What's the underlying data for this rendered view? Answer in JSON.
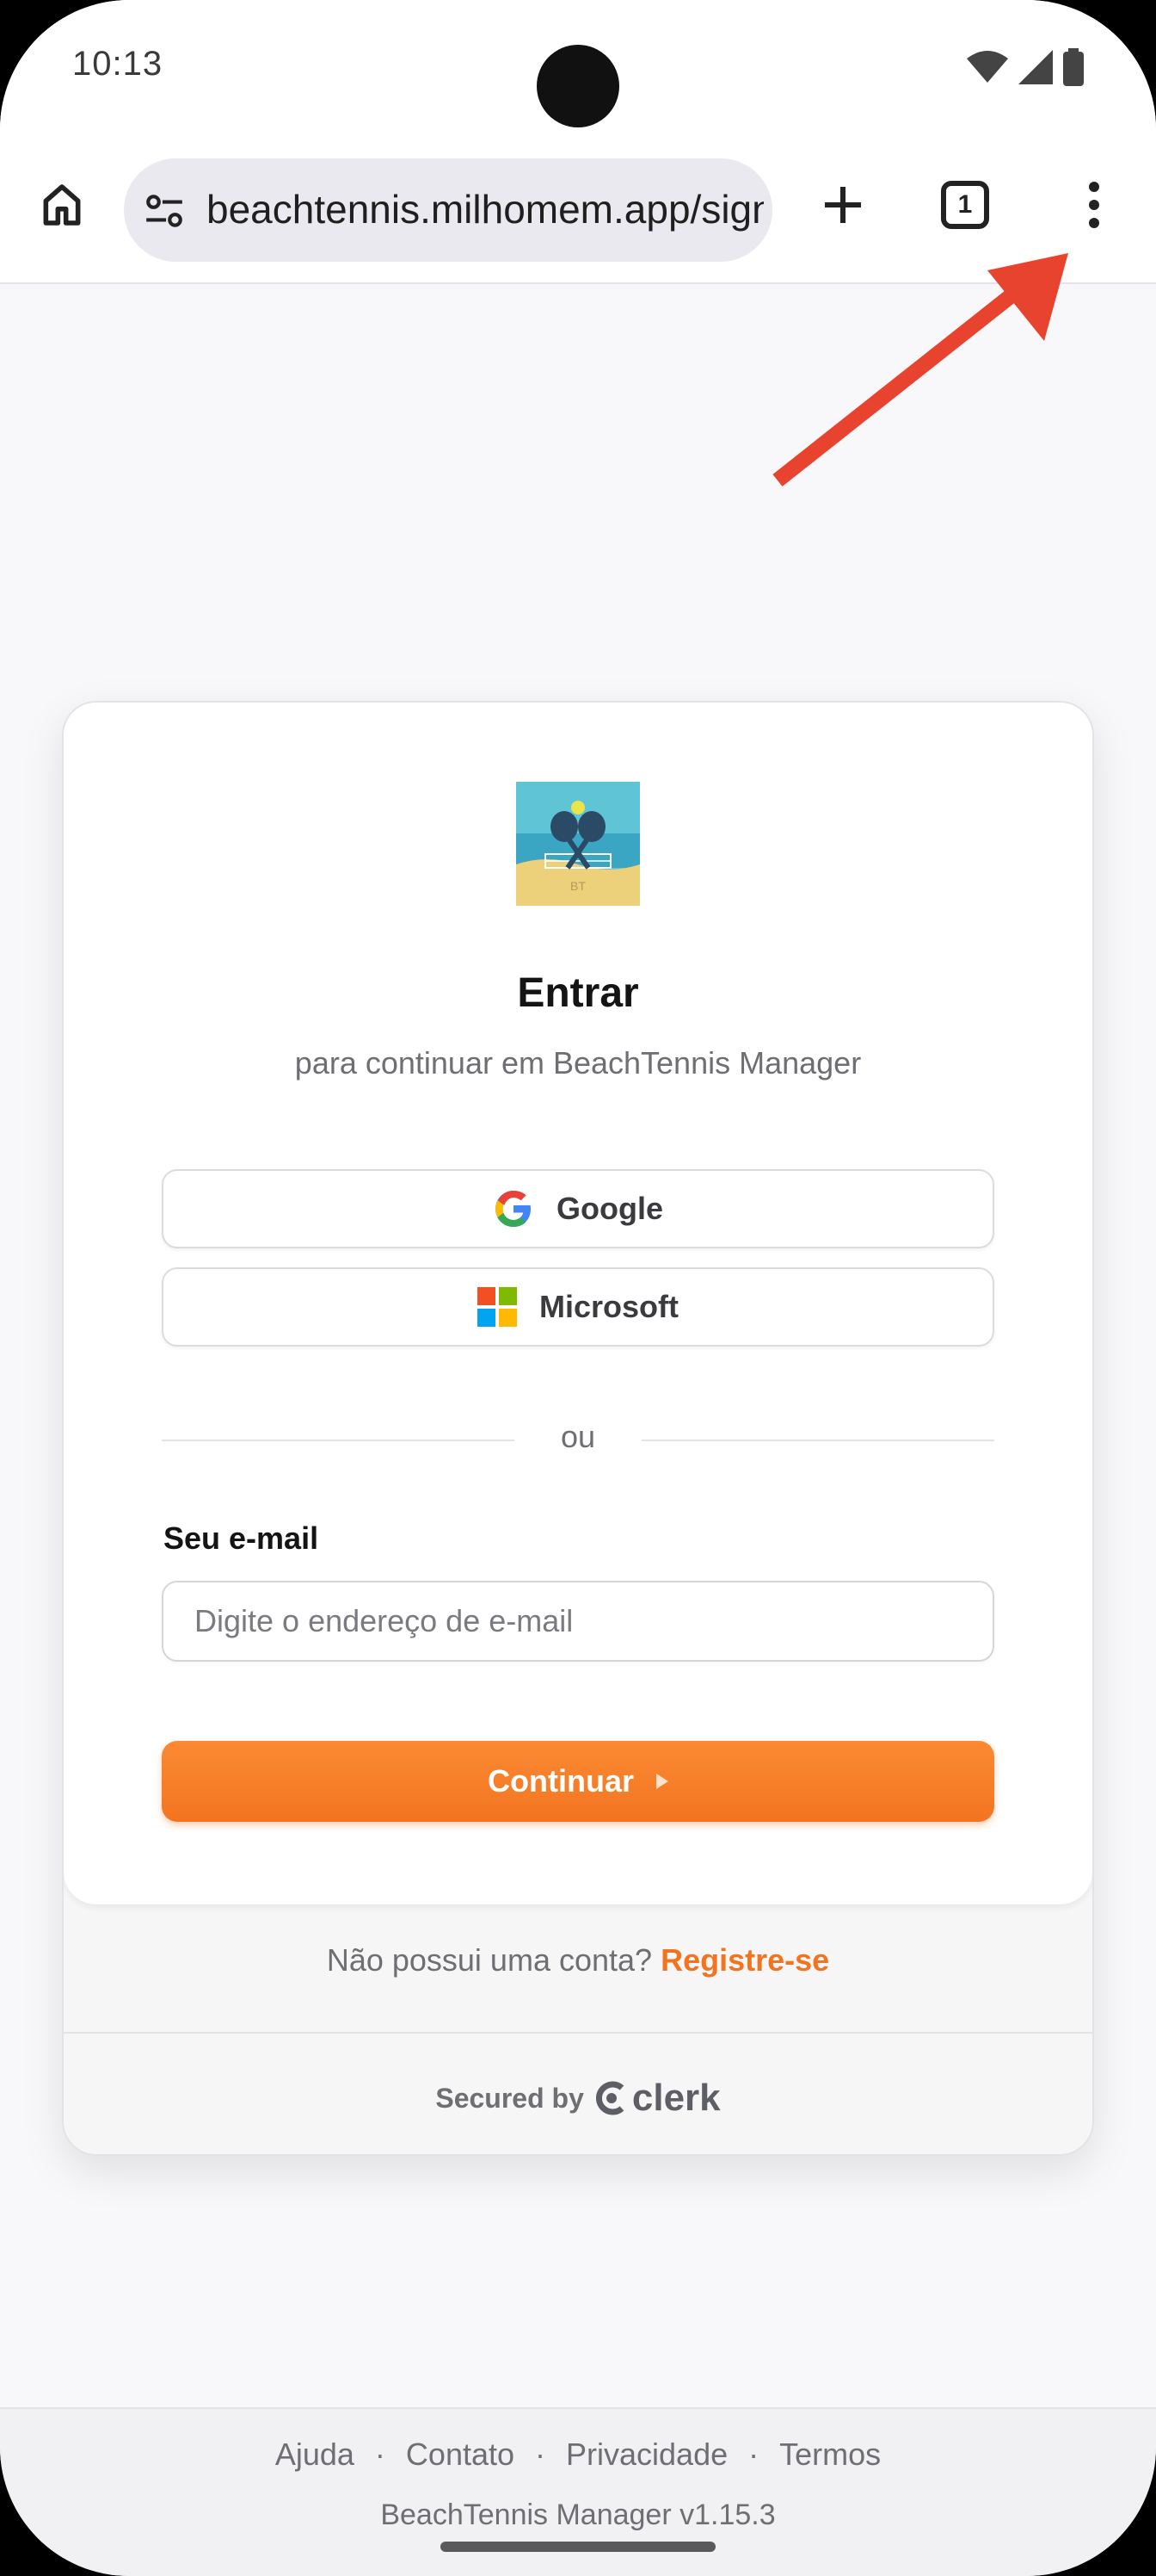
{
  "status_bar": {
    "time": "10:13"
  },
  "browser": {
    "url": "beachtennis.milhomem.app/sign-in",
    "tab_count": "1"
  },
  "signin": {
    "logo_text": "BT",
    "title": "Entrar",
    "subtitle": "para continuar em BeachTennis Manager",
    "google_label": "Google",
    "microsoft_label": "Microsoft",
    "divider": "ou",
    "email_label": "Seu e-mail",
    "email_placeholder": "Digite o endereço de e-mail",
    "email_value": "",
    "continue_label": "Continuar",
    "signup_prompt": "Não possui uma conta?",
    "signup_link": "Registre-se",
    "secured_by": "Secured by",
    "clerk": "clerk"
  },
  "footer": {
    "links": [
      "Ajuda",
      "Contato",
      "Privacidade",
      "Termos"
    ],
    "version": "BeachTennis Manager v1.15.3"
  },
  "colors": {
    "accent": "#f37420",
    "annotation_arrow": "#e8432e"
  }
}
